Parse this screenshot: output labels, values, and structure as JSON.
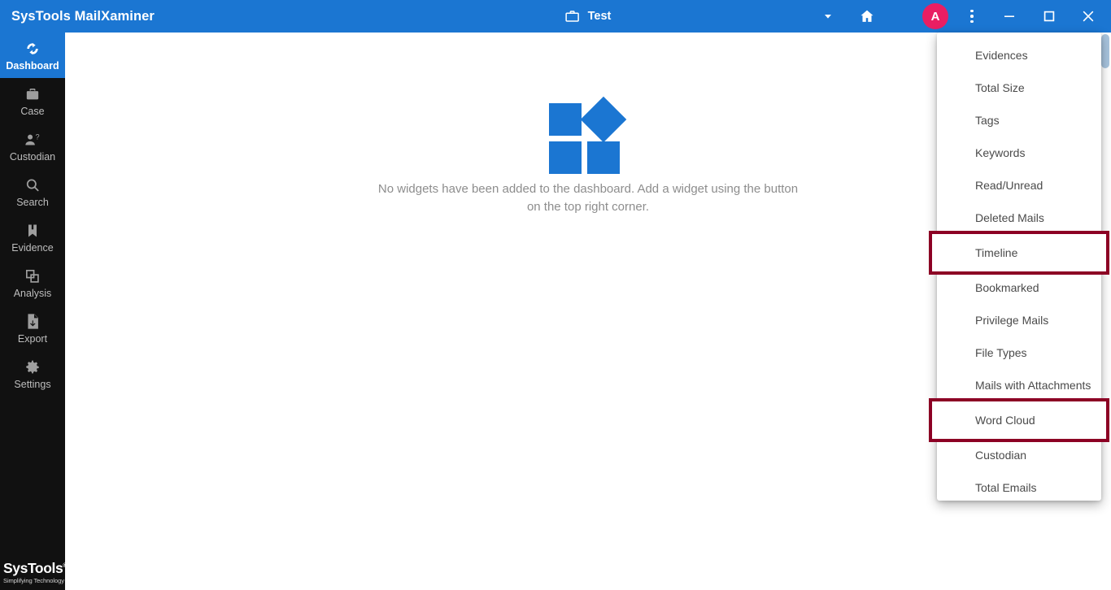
{
  "titlebar": {
    "app_title": "SysTools MailXaminer",
    "case_icon": "briefcase-icon",
    "case_name": "Test",
    "dropdown_icon": "chevron-down-icon",
    "home_icon": "home-icon",
    "avatar_initial": "A",
    "kebab_icon": "more-vertical-icon",
    "minimize_icon": "minimize-icon",
    "maximize_icon": "maximize-icon",
    "close_icon": "close-icon",
    "bg_color": "#1b76d2",
    "avatar_color": "#e91e63"
  },
  "sidebar": {
    "bg_color": "#111111",
    "active_color": "#1b76d2",
    "items": [
      {
        "label": "Dashboard",
        "icon": "dashboard-icon",
        "active": true
      },
      {
        "label": "Case",
        "icon": "briefcase-icon",
        "active": false
      },
      {
        "label": "Custodian",
        "icon": "person-question-icon",
        "active": false
      },
      {
        "label": "Search",
        "icon": "search-icon",
        "active": false
      },
      {
        "label": "Evidence",
        "icon": "bookmark-icon",
        "active": false
      },
      {
        "label": "Analysis",
        "icon": "layers-icon",
        "active": false
      },
      {
        "label": "Export",
        "icon": "file-export-icon",
        "active": false
      },
      {
        "label": "Settings",
        "icon": "gear-icon",
        "active": false
      }
    ],
    "brand": {
      "name": "SysTools",
      "registered": "®",
      "tagline": "Simplifying Technology"
    }
  },
  "main": {
    "empty_state": {
      "glyph": "widget-placeholder-icon",
      "glyph_color": "#1b76d2",
      "message": "No widgets have been added to the dashboard. Add a widget using the button on the top right corner."
    }
  },
  "scrollbar": {
    "thumb_color": "#a8c4de"
  },
  "widget_menu": {
    "highlight_color": "#8c0024",
    "items": [
      {
        "label": "Evidences",
        "highlighted": false
      },
      {
        "label": "Total Size",
        "highlighted": false
      },
      {
        "label": "Tags",
        "highlighted": false
      },
      {
        "label": "Keywords",
        "highlighted": false
      },
      {
        "label": "Read/Unread",
        "highlighted": false
      },
      {
        "label": "Deleted Mails",
        "highlighted": false
      },
      {
        "label": "Timeline",
        "highlighted": true
      },
      {
        "label": "Bookmarked",
        "highlighted": false
      },
      {
        "label": "Privilege Mails",
        "highlighted": false
      },
      {
        "label": "File Types",
        "highlighted": false
      },
      {
        "label": "Mails with Attachments",
        "highlighted": false
      },
      {
        "label": "Word Cloud",
        "highlighted": true
      },
      {
        "label": "Custodian",
        "highlighted": false
      },
      {
        "label": "Total Emails",
        "highlighted": false
      }
    ]
  }
}
